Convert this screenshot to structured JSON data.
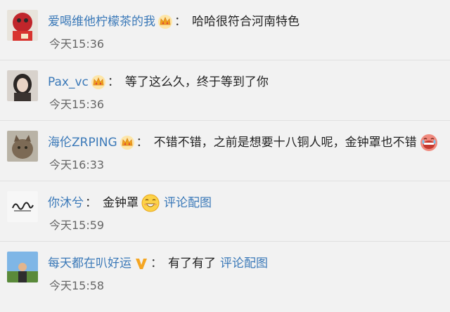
{
  "comments": [
    {
      "username": "爱喝维他柠檬茶的我",
      "badge": "crown-icon",
      "colon": "：",
      "text": "哈哈很符合河南特色",
      "time": "今天15:36"
    },
    {
      "username": "Pax_vc",
      "badge": "crown-icon",
      "colon": "：",
      "text": "等了这么久，终于等到了你",
      "time": "今天15:36"
    },
    {
      "username": "海伦ZRPING",
      "badge": "crown-icon",
      "colon": "：",
      "text": "不错不错，之前是想要十八铜人呢，金钟罩也不错",
      "emoji": "crying-face-icon",
      "time": "今天16:33"
    },
    {
      "username": "你沐兮",
      "colon": "：",
      "text": "金钟罩",
      "emoji": "grinning-face-icon",
      "image_link": "评论配图",
      "time": "今天15:59"
    },
    {
      "username": "每天都在叭好运",
      "badge": "v-verified-icon",
      "colon": "：",
      "text": "有了有了",
      "image_link": "评论配图",
      "time": "今天15:58"
    }
  ],
  "colors": {
    "background": "#f2f2f2",
    "username": "#3b79b8",
    "text": "#222222",
    "timestamp": "#666666",
    "verified_badge": "#f5a623"
  }
}
